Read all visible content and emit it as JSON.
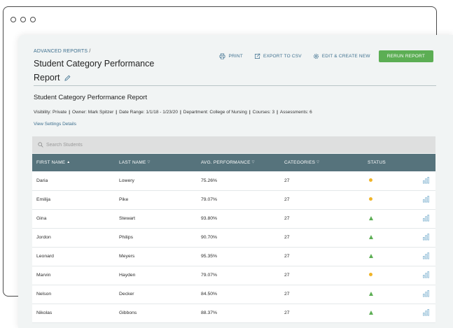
{
  "breadcrumb": {
    "parent": "ADVANCED REPORTS",
    "separator": "/"
  },
  "page": {
    "title": "Student Category Performance Report"
  },
  "actions": {
    "print": "PRINT",
    "export": "EXPORT TO CSV",
    "edit": "EDIT & CREATE NEW",
    "rerun": "RERUN REPORT"
  },
  "report": {
    "title": "Student Category Performance Report",
    "meta": {
      "visibility": "Visibility: Private",
      "owner": "Owner: Mark Spitzer",
      "date_range": "Date Range: 1/1/18 - 1/23/20",
      "department": "Department: College of Nursing",
      "courses": "Courses: 3",
      "assessments": "Assessments:  6"
    },
    "view_settings": "View Settings Details"
  },
  "search": {
    "placeholder": "Search Students"
  },
  "table": {
    "columns": {
      "first_name": "FIRST NAME",
      "last_name": "LAST NAME",
      "avg_performance": "AVG. PERFORMANCE",
      "categories": "CATEGORIES",
      "status": "STATUS"
    },
    "rows": [
      {
        "first": "Daria",
        "last": "Lowery",
        "avg": "75.26%",
        "categories": "27",
        "status": "warning"
      },
      {
        "first": "Emilija",
        "last": "Pike",
        "avg": "79.07%",
        "categories": "27",
        "status": "warning"
      },
      {
        "first": "Gina",
        "last": "Stewart",
        "avg": "93.80%",
        "categories": "27",
        "status": "good"
      },
      {
        "first": "Jordon",
        "last": "Philips",
        "avg": "90.70%",
        "categories": "27",
        "status": "good"
      },
      {
        "first": "Leonard",
        "last": "Meyers",
        "avg": "95.35%",
        "categories": "27",
        "status": "good"
      },
      {
        "first": "Marvin",
        "last": "Hayden",
        "avg": "79.07%",
        "categories": "27",
        "status": "warning"
      },
      {
        "first": "Nelson",
        "last": "Decker",
        "avg": "84.50%",
        "categories": "27",
        "status": "good"
      },
      {
        "first": "Nikolas",
        "last": "Gibbons",
        "avg": "88.37%",
        "categories": "27",
        "status": "good"
      }
    ]
  },
  "colors": {
    "accent": "#3d6f8e",
    "header": "#56737c",
    "success": "#5cae54",
    "warning": "#f0b428"
  }
}
